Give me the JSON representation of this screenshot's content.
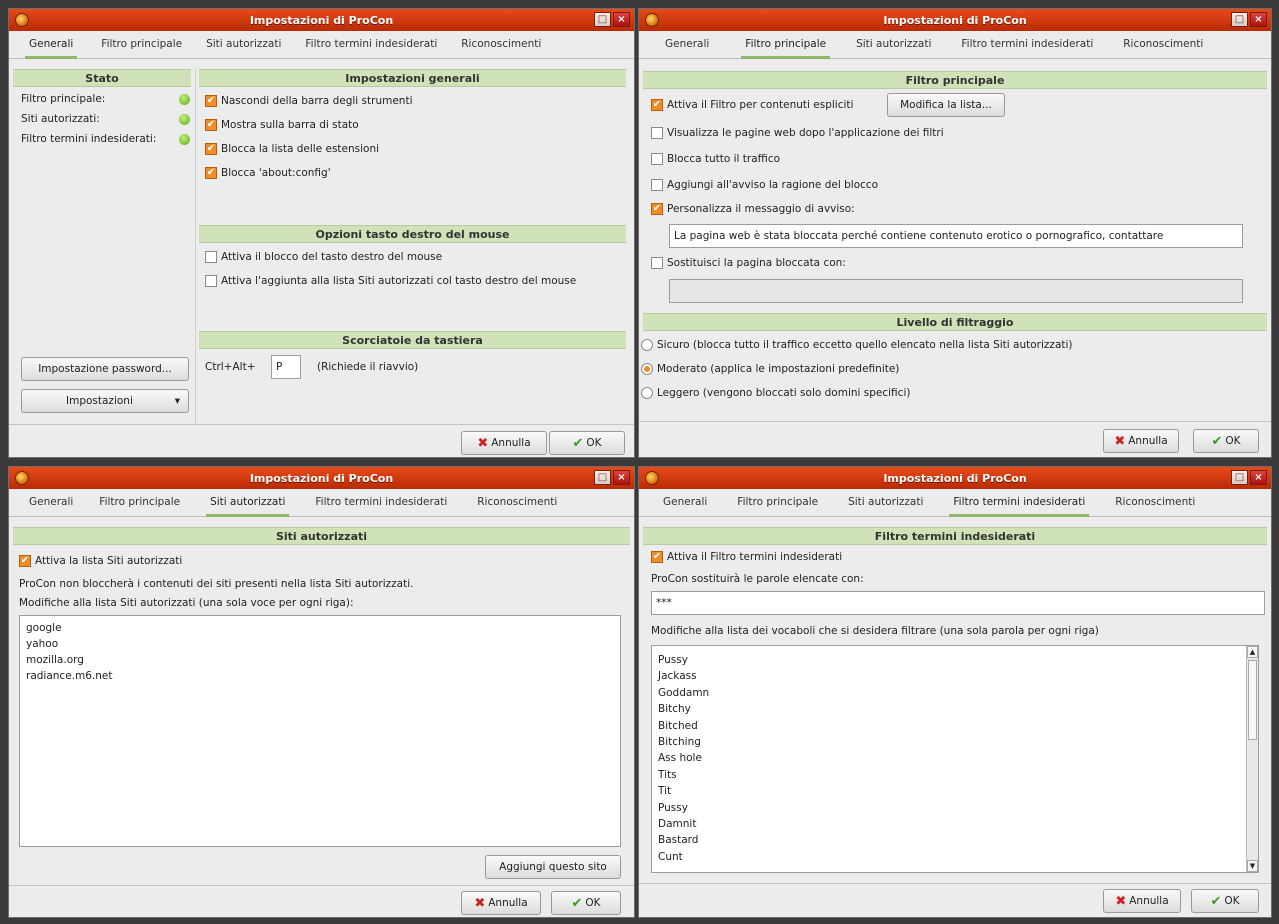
{
  "window_title": "Impostazioni di ProCon",
  "tabs": [
    "Generali",
    "Filtro principale",
    "Siti autorizzati",
    "Filtro termini indesiderati",
    "Riconoscimenti"
  ],
  "buttons": {
    "cancel": "Annulla",
    "ok": "OK"
  },
  "win1": {
    "stato_header": "Stato",
    "stato_items": [
      "Filtro principale:",
      "Siti autorizzati:",
      "Filtro termini indesiderati:"
    ],
    "impostazioni_header": "Impostazioni generali",
    "impostazioni_items": [
      {
        "label": "Nascondi della barra degli strumenti",
        "checked": true
      },
      {
        "label": "Mostra sulla barra di stato",
        "checked": true
      },
      {
        "label": "Blocca la lista delle estensioni",
        "checked": true
      },
      {
        "label": "Blocca 'about:config'",
        "checked": true
      }
    ],
    "mouse_header": "Opzioni tasto destro del mouse",
    "mouse_items": [
      {
        "label": "Attiva il blocco del tasto destro del mouse",
        "checked": false
      },
      {
        "label": "Attiva l'aggiunta alla lista Siti autorizzati col tasto destro del mouse",
        "checked": false
      }
    ],
    "shortcut_header": "Scorciatoie da tastiera",
    "shortcut_prefix": "Ctrl+Alt+",
    "shortcut_key": "P",
    "shortcut_note": "(Richiede il riavvio)",
    "password_button": "Impostazione password...",
    "impostazioni_dropdown": "Impostazioni"
  },
  "win2": {
    "header": "Filtro principale",
    "attiva_label": "Attiva il Filtro per contenuti espliciti",
    "modifica_button": "Modifica la lista...",
    "visualizza_label": "Visualizza le pagine web dopo l'applicazione dei filtri",
    "blocca_label": "Blocca tutto il traffico",
    "aggiungi_label": "Aggiungi all'avviso la ragione del blocco",
    "personalizza_label": "Personalizza il messaggio di avviso:",
    "message_value": "La pagina web è stata bloccata perché contiene contenuto erotico o pornografico, contattare",
    "sostituisci_label": "Sostituisci la pagina bloccata con:",
    "livello_header": "Livello di filtraggio",
    "levels": [
      {
        "label": "Sicuro (blocca tutto il traffico eccetto quello elencato nella lista Siti autorizzati)",
        "selected": false
      },
      {
        "label": "Moderato (applica le impostazioni predefinite)",
        "selected": true
      },
      {
        "label": "Leggero (vengono bloccati solo domini specifici)",
        "selected": false
      }
    ]
  },
  "win3": {
    "header": "Siti autorizzati",
    "attiva_label": "Attiva la lista Siti autorizzati",
    "desc": "ProCon non bloccherà i contenuti dei siti presenti nella lista Siti autorizzati.",
    "modifiche_label": "Modifiche alla lista Siti autorizzati (una sola voce per ogni riga):",
    "sites": [
      "google",
      "yahoo",
      "mozilla.org",
      "radiance.m6.net"
    ],
    "aggiungi_button": "Aggiungi questo sito"
  },
  "win4": {
    "header": "Filtro termini indesiderati",
    "attiva_label": "Attiva il Filtro termini indesiderati",
    "sostituira_label": "ProCon sostituirà le parole elencate con:",
    "replacement": "***",
    "modifiche_label": "Modifiche alla lista dei vocaboli che si desidera filtrare (una sola parola per ogni riga)",
    "words": [
      "Pussy",
      "Jackass",
      "Goddamn",
      "Bitchy",
      "Bitched",
      "Bitching",
      "Ass hole",
      "Tits",
      "Tit",
      "Pussy",
      "Damnit",
      "Bastard",
      "Cunt"
    ]
  }
}
